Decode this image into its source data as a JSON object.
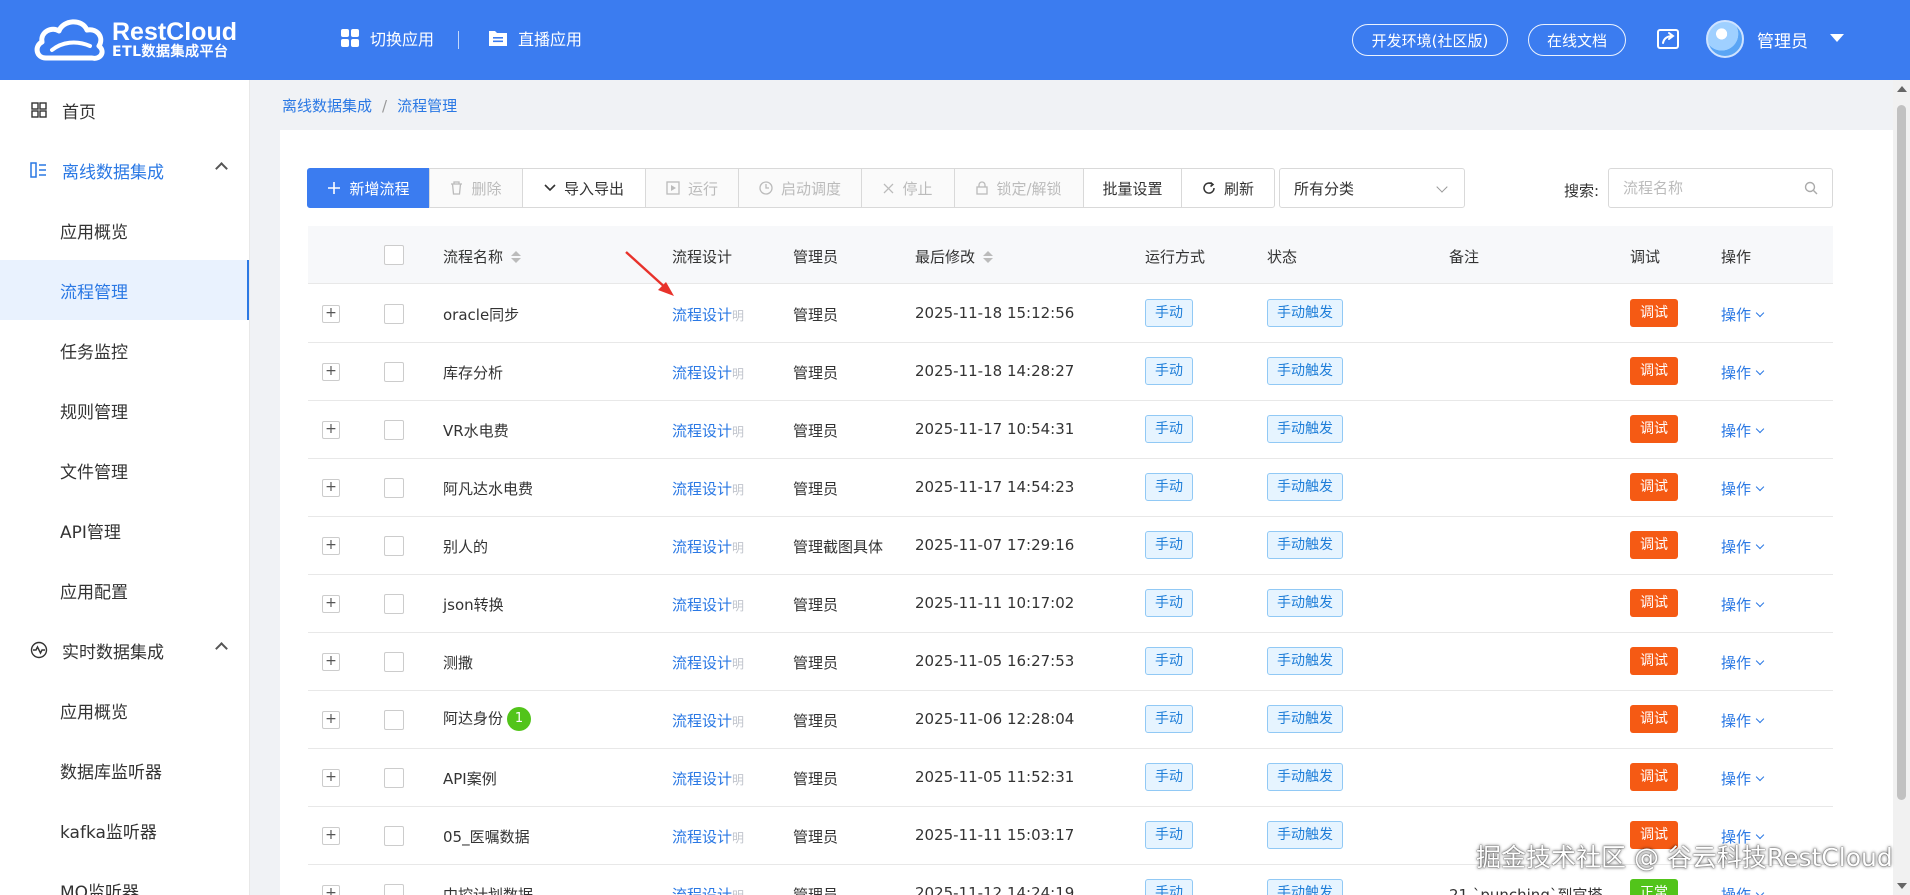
{
  "header": {
    "logo_title": "RestCloud",
    "logo_subtitle": "ETL数据集成平台",
    "nav": [
      {
        "label": "切换应用",
        "icon": "grid-icon"
      },
      {
        "label": "直播应用",
        "icon": "folder-icon"
      }
    ],
    "env_button": "开发环境(社区版)",
    "docs_button": "在线文档",
    "user_name": "管理员"
  },
  "sidebar": {
    "items": [
      {
        "label": "首页",
        "level": "top"
      },
      {
        "label": "离线数据集成",
        "level": "group"
      },
      {
        "label": "应用概览",
        "level": "sub"
      },
      {
        "label": "流程管理",
        "level": "sub",
        "active": true
      },
      {
        "label": "任务监控",
        "level": "sub"
      },
      {
        "label": "规则管理",
        "level": "sub"
      },
      {
        "label": "文件管理",
        "level": "sub"
      },
      {
        "label": "API管理",
        "level": "sub"
      },
      {
        "label": "应用配置",
        "level": "sub"
      },
      {
        "label": "实时数据集成",
        "level": "group"
      },
      {
        "label": "应用概览",
        "level": "sub"
      },
      {
        "label": "数据库监听器",
        "level": "sub"
      },
      {
        "label": "kafka监听器",
        "level": "sub"
      },
      {
        "label": "MQ监听器",
        "level": "sub"
      }
    ]
  },
  "breadcrumb": {
    "parent": "离线数据集成",
    "sep": "/",
    "current": "流程管理"
  },
  "toolbar": {
    "add": "新增流程",
    "delete": "删除",
    "import_export": "导入导出",
    "run": "运行",
    "start_schedule": "启动调度",
    "stop": "停止",
    "lock": "锁定/解锁",
    "batch": "批量设置",
    "refresh": "刷新",
    "category": "所有分类",
    "search_label": "搜索:",
    "search_placeholder": "流程名称"
  },
  "table": {
    "columns": {
      "name": "流程名称",
      "design": "流程设计",
      "admin": "管理员",
      "modified": "最后修改",
      "run_mode": "运行方式",
      "status": "状态",
      "remark": "备注",
      "debug": "调试",
      "ops": "操作"
    },
    "rows": [
      {
        "name": "oracle同步",
        "design": "流程设计",
        "design_suffix": "明",
        "admin": "管理员",
        "modified": "2025-11-18 15:12:56",
        "run_mode": "手动",
        "status": "手动触发",
        "remark": "",
        "debug": "调试",
        "ops": "操作"
      },
      {
        "name": "库存分析",
        "design": "流程设计",
        "design_suffix": "明",
        "admin": "管理员",
        "modified": "2025-11-18 14:28:27",
        "run_mode": "手动",
        "status": "手动触发",
        "remark": "",
        "debug": "调试",
        "ops": "操作"
      },
      {
        "name": "VR水电费",
        "design": "流程设计",
        "design_suffix": "明",
        "admin": "管理员",
        "modified": "2025-11-17 10:54:31",
        "run_mode": "手动",
        "status": "手动触发",
        "remark": "",
        "debug": "调试",
        "ops": "操作"
      },
      {
        "name": "阿凡达水电费",
        "design": "流程设计",
        "design_suffix": "明",
        "admin": "管理员",
        "modified": "2025-11-17 14:54:23",
        "run_mode": "手动",
        "status": "手动触发",
        "remark": "",
        "debug": "调试",
        "ops": "操作"
      },
      {
        "name": "别人的",
        "design": "流程设计",
        "design_suffix": "明",
        "admin": "管理截图具体",
        "modified": "2025-11-07 17:29:16",
        "run_mode": "手动",
        "status": "手动触发",
        "remark": "",
        "debug": "调试",
        "ops": "操作"
      },
      {
        "name": "json转换",
        "design": "流程设计",
        "design_suffix": "明",
        "admin": "管理员",
        "modified": "2025-11-11 10:17:02",
        "run_mode": "手动",
        "status": "手动触发",
        "remark": "",
        "debug": "调试",
        "ops": "操作"
      },
      {
        "name": "测撒",
        "design": "流程设计",
        "design_suffix": "明",
        "admin": "管理员",
        "modified": "2025-11-05 16:27:53",
        "run_mode": "手动",
        "status": "手动触发",
        "remark": "",
        "debug": "调试",
        "ops": "操作"
      },
      {
        "name": "阿达身份",
        "badge": "1",
        "design": "流程设计",
        "design_suffix": "明",
        "admin": "管理员",
        "modified": "2025-11-06 12:28:04",
        "run_mode": "手动",
        "status": "手动触发",
        "remark": "",
        "debug": "调试",
        "ops": "操作"
      },
      {
        "name": "API案例",
        "design": "流程设计",
        "design_suffix": "明",
        "admin": "管理员",
        "modified": "2025-11-05 11:52:31",
        "run_mode": "手动",
        "status": "手动触发",
        "remark": "",
        "debug": "调试",
        "ops": "操作"
      },
      {
        "name": "05_医嘱数据",
        "design": "流程设计",
        "design_suffix": "明",
        "admin": "管理员",
        "modified": "2025-11-11 15:03:17",
        "run_mode": "手动",
        "status": "手动触发",
        "remark": "",
        "debug": "调试",
        "ops": "操作"
      },
      {
        "name": "中控计划数据",
        "design": "流程设计",
        "design_suffix": "明",
        "admin": "管理员",
        "modified": "2025-11-12 14:24:19",
        "run_mode": "手动",
        "status": "手动触发",
        "remark": "21 `punching`到官塔",
        "debug": "正常",
        "ops": "操作"
      }
    ]
  },
  "watermark": "掘金技术社区 @ 谷云科技RestCloud",
  "colors": {
    "brand": "#3b7cf0",
    "link": "#2a78e4",
    "debug": "#f55a14",
    "tag_bg": "#e6f4ff",
    "badge": "#52c41a"
  }
}
